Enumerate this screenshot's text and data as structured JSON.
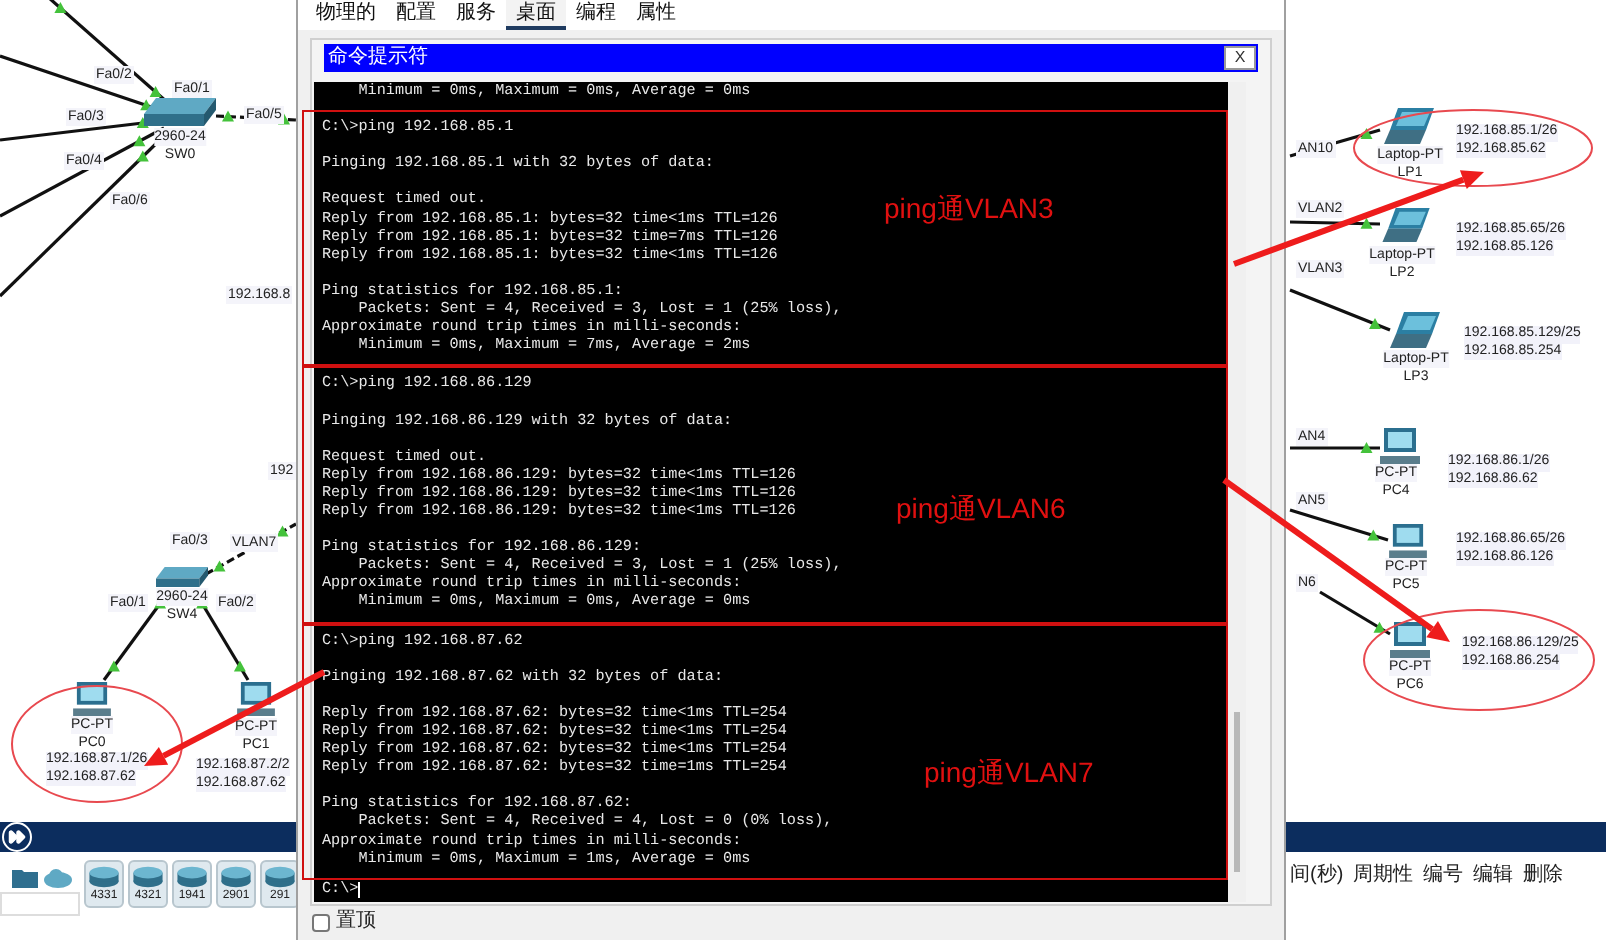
{
  "canvas": {
    "labels": [
      "Fa0/2",
      "Fa0/1",
      "Fa0/3",
      "Fa0/5",
      "Fa0/4",
      "Fa0/6",
      "192.168.8",
      "192",
      "Fa0/3",
      "VLAN7",
      "Fa0/1",
      "Fa0/2",
      "AN10",
      "VLAN2",
      "VLAN3",
      "AN4",
      "AN5",
      "N6"
    ],
    "devices": [
      {
        "kind": "switch",
        "model": "2960-24",
        "name": "SW0",
        "circled": false
      },
      {
        "kind": "switch",
        "model": "2960-24",
        "name": "SW4",
        "circled": false
      },
      {
        "kind": "pc",
        "model": "PC-PT",
        "name": "PC0",
        "ips": [
          "192.168.87.1/26",
          "192.168.87.62"
        ],
        "circled": true
      },
      {
        "kind": "pc",
        "model": "PC-PT",
        "name": "PC1",
        "ips": [
          "192.168.87.2/2",
          "192.168.87.62"
        ],
        "circled": false
      },
      {
        "kind": "laptop",
        "model": "Laptop-PT",
        "name": "LP1",
        "ips": [
          "192.168.85.1/26",
          "192.168.85.62"
        ],
        "circled": true
      },
      {
        "kind": "laptop",
        "model": "Laptop-PT",
        "name": "LP2",
        "ips": [
          "192.168.85.65/26",
          "192.168.85.126"
        ],
        "circled": false
      },
      {
        "kind": "laptop",
        "model": "Laptop-PT",
        "name": "LP3",
        "ips": [
          "192.168.85.129/25",
          "192.168.85.254"
        ],
        "circled": false
      },
      {
        "kind": "pc",
        "model": "PC-PT",
        "name": "PC4",
        "ips": [
          "192.168.86.1/26",
          "192.168.86.62"
        ],
        "circled": false
      },
      {
        "kind": "pc",
        "model": "PC-PT",
        "name": "PC5",
        "ips": [
          "192.168.86.65/26",
          "192.168.86.126"
        ],
        "circled": false
      },
      {
        "kind": "pc",
        "model": "PC-PT",
        "name": "PC6",
        "ips": [
          "192.168.86.129/25",
          "192.168.86.254"
        ],
        "circled": true
      }
    ]
  },
  "dialog": {
    "tabs": [
      {
        "label": "物理的",
        "selected": false
      },
      {
        "label": "配置",
        "selected": false
      },
      {
        "label": "服务",
        "selected": false
      },
      {
        "label": "桌面",
        "selected": true
      },
      {
        "label": "编程",
        "selected": false
      },
      {
        "label": "属性",
        "selected": false
      }
    ],
    "window_title": "命令提示符",
    "close": "X",
    "terminal": {
      "preamble": "    Minimum = 0ms, Maximum = 0ms, Average = 0ms",
      "pings": [
        {
          "annotation": "ping通VLAN3",
          "paragraphs": [
            [
              "C:\\>ping 192.168.85.1"
            ],
            [
              "Pinging 192.168.85.1 with 32 bytes of data:"
            ],
            [
              "Request timed out.",
              "Reply from 192.168.85.1: bytes=32 time<1ms TTL=126",
              "Reply from 192.168.85.1: bytes=32 time=7ms TTL=126",
              "Reply from 192.168.85.1: bytes=32 time<1ms TTL=126"
            ],
            [
              "Ping statistics for 192.168.85.1:",
              "    Packets: Sent = 4, Received = 3, Lost = 1 (25% loss),",
              "Approximate round trip times in milli-seconds:",
              "    Minimum = 0ms, Maximum = 7ms, Average = 2ms"
            ]
          ]
        },
        {
          "annotation": "ping通VLAN6",
          "paragraphs": [
            [
              "C:\\>ping 192.168.86.129"
            ],
            [
              "Pinging 192.168.86.129 with 32 bytes of data:"
            ],
            [
              "Request timed out.",
              "Reply from 192.168.86.129: bytes=32 time<1ms TTL=126",
              "Reply from 192.168.86.129: bytes=32 time<1ms TTL=126",
              "Reply from 192.168.86.129: bytes=32 time<1ms TTL=126"
            ],
            [
              "Ping statistics for 192.168.86.129:",
              "    Packets: Sent = 4, Received = 3, Lost = 1 (25% loss),",
              "Approximate round trip times in milli-seconds:",
              "    Minimum = 0ms, Maximum = 0ms, Average = 0ms"
            ]
          ]
        },
        {
          "annotation": "ping通VLAN7",
          "paragraphs": [
            [
              "C:\\>ping 192.168.87.62"
            ],
            [
              "Pinging 192.168.87.62 with 32 bytes of data:"
            ],
            [
              "Reply from 192.168.87.62: bytes=32 time<1ms TTL=254",
              "Reply from 192.168.87.62: bytes=32 time<1ms TTL=254",
              "Reply from 192.168.87.62: bytes=32 time<1ms TTL=254",
              "Reply from 192.168.87.62: bytes=32 time=1ms TTL=254"
            ],
            [
              "Ping statistics for 192.168.87.62:",
              "    Packets: Sent = 4, Received = 4, Lost = 0 (0% loss),",
              "Approximate round trip times in milli-seconds:",
              "    Minimum = 0ms, Maximum = 1ms, Average = 0ms"
            ]
          ]
        }
      ],
      "prompt": "C:\\>"
    },
    "pin_on_top": {
      "label": "置顶",
      "checked": false
    }
  },
  "device_palette": [
    "4331",
    "4321",
    "1941",
    "2901",
    "291"
  ],
  "event_columns": [
    "间(秒)",
    "周期性",
    "编号",
    "编辑",
    "删除"
  ]
}
